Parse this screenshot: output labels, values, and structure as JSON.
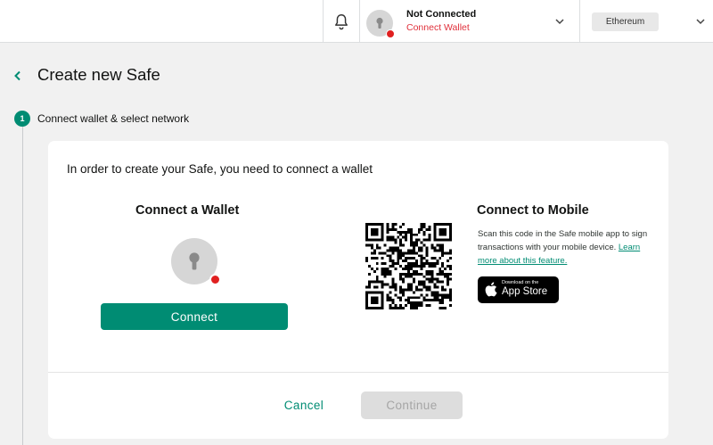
{
  "header": {
    "connection_status": "Not Connected",
    "connect_prompt": "Connect Wallet",
    "network_name": "Ethereum",
    "icons": {
      "notifications": "bell-icon",
      "dropdown": "chevron-down-icon"
    },
    "colors": {
      "error": "#e0303b"
    }
  },
  "page": {
    "title": "Create new Safe",
    "back_icon": "chevron-left-icon"
  },
  "stepper": {
    "current_step_number": "1",
    "current_step_label": "Connect wallet & select network"
  },
  "card": {
    "intro_text": "In order to create your Safe, you need to connect a wallet",
    "connect_wallet": {
      "title": "Connect a Wallet",
      "button_label": "Connect"
    },
    "connect_mobile": {
      "title": "Connect to Mobile",
      "description": "Scan this code in the Safe mobile app to sign transactions with your mobile device. ",
      "learn_more_link": "Learn more about this feature.",
      "app_store_small": "Download on the",
      "app_store_big": "App Store"
    },
    "footer": {
      "cancel_label": "Cancel",
      "continue_label": "Continue"
    }
  },
  "colors": {
    "primary": "#008c73",
    "disabled_bg": "#dddddd",
    "disabled_text": "#a5a5a5",
    "background": "#f1f1f1"
  }
}
